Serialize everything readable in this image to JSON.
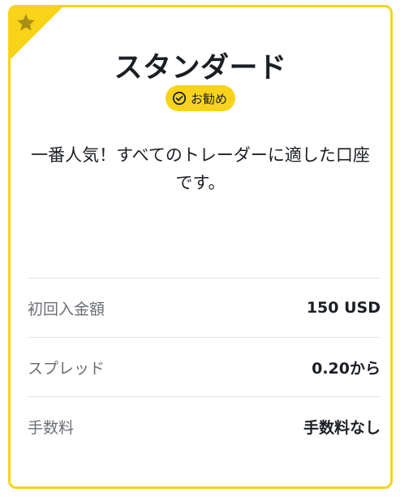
{
  "card": {
    "title": "スタンダード",
    "badge_label": "お勧め",
    "description_line1": "一番人気！すべてのトレーダーに適した口座",
    "description_line2": "です。",
    "rows": [
      {
        "label": "初回入金額",
        "value": "150 USD"
      },
      {
        "label": "スプレッド",
        "value": "0.20から"
      },
      {
        "label": "手数料",
        "value": "手数料なし"
      }
    ]
  },
  "icons": {
    "corner": "star-icon",
    "badge": "check-circle-icon"
  },
  "colors": {
    "accent": "#f8d31a",
    "text": "#1b1f24",
    "muted": "#6b6f75",
    "divider": "#e3e3e3"
  }
}
